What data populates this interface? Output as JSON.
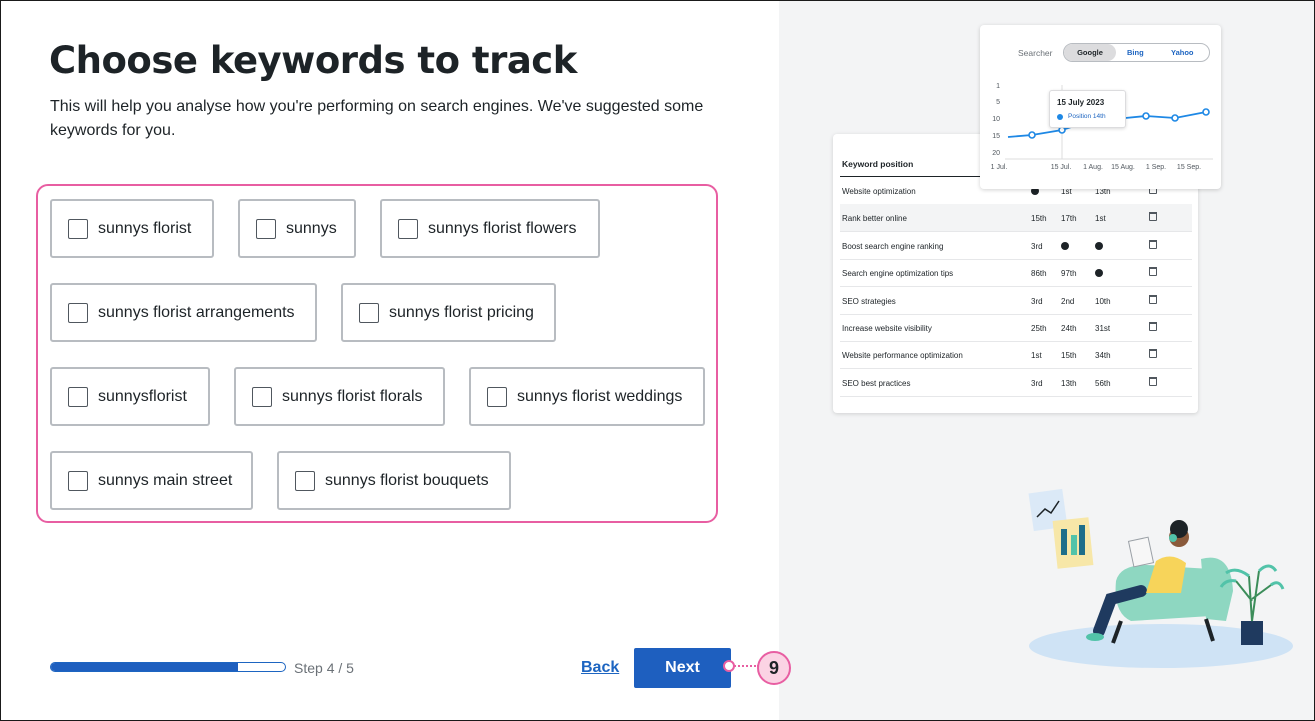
{
  "page": {
    "title": "Choose keywords to track",
    "subtitle": "This will help you analyse how you're performing on search engines. We've suggested some keywords for you."
  },
  "keywords": [
    {
      "label": "sunnys florist",
      "checked": false
    },
    {
      "label": "sunnys",
      "checked": false
    },
    {
      "label": "sunnys florist flowers",
      "checked": false
    },
    {
      "label": "sunnys florist arrangements",
      "checked": false
    },
    {
      "label": "sunnys florist pricing",
      "checked": false
    },
    {
      "label": "sunnysflorist",
      "checked": false
    },
    {
      "label": "sunnys florist florals",
      "checked": false
    },
    {
      "label": "sunnys florist weddings",
      "checked": false
    },
    {
      "label": "sunnys main street",
      "checked": false
    },
    {
      "label": "sunnys florist bouquets",
      "checked": false
    }
  ],
  "footer": {
    "progress_fraction": 0.8,
    "step_text": "Step 4 / 5",
    "back_label": "Back",
    "next_label": "Next",
    "callout_number": "9"
  },
  "illustration": {
    "chart": {
      "searcher_label": "Searcher",
      "engines": [
        "Google",
        "Bing",
        "Yahoo"
      ],
      "selected_engine": "Google",
      "y_ticks": [
        "1",
        "5",
        "10",
        "15",
        "20"
      ],
      "x_ticks": [
        "1 Jul.",
        "15 Jul.",
        "1 Aug.",
        "15 Aug.",
        "1 Sep.",
        "15 Sep."
      ],
      "tooltip_date": "15 July 2023",
      "tooltip_position": "Position 14th",
      "line_color": "#1e88e5"
    },
    "table": {
      "header": "Keyword position",
      "rows": [
        {
          "keyword": "Website optimization",
          "c1": "clock",
          "c2": "1st",
          "c3": "13th"
        },
        {
          "keyword": "Rank better online",
          "c1": "15th",
          "c2": "17th",
          "c3": "1st"
        },
        {
          "keyword": "Boost search engine ranking",
          "c1": "3rd",
          "c2": "clock",
          "c3": "clock"
        },
        {
          "keyword": "Search engine optimization tips",
          "c1": "86th",
          "c2": "97th",
          "c3": "clock"
        },
        {
          "keyword": "SEO strategies",
          "c1": "3rd",
          "c2": "2nd",
          "c3": "10th"
        },
        {
          "keyword": "Increase website visibility",
          "c1": "25th",
          "c2": "24th",
          "c3": "31st"
        },
        {
          "keyword": "Website performance optimization",
          "c1": "1st",
          "c2": "15th",
          "c3": "34th"
        },
        {
          "keyword": "SEO best practices",
          "c1": "3rd",
          "c2": "13th",
          "c3": "56th"
        }
      ]
    }
  },
  "colors": {
    "primary": "#1e5fbf",
    "highlight": "#e85ea2",
    "text": "#1d2327"
  }
}
